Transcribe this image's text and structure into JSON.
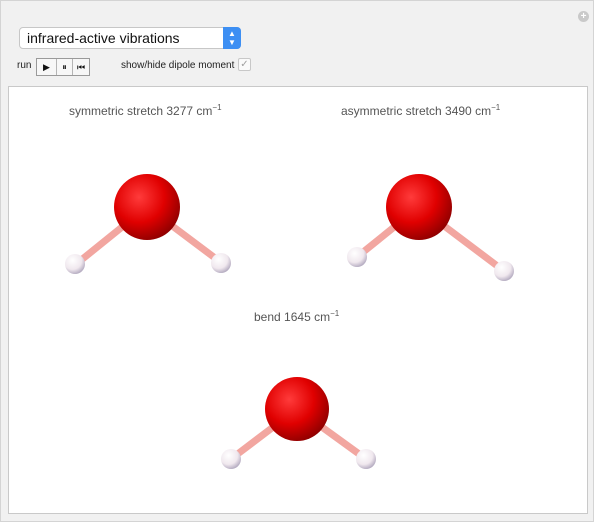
{
  "controls": {
    "dropdown_value": "infrared-active vibrations",
    "run_label": "run",
    "play_symbol": "▶",
    "pause_symbol": "⏸",
    "reset_symbol": "⏮",
    "dipole_label": "show/hide dipole moment",
    "dipole_checked": "✓",
    "corner_button": "+"
  },
  "modes": [
    {
      "name": "symmetric stretch",
      "wavenumber": "3277",
      "unit": "cm",
      "exponent": "−1"
    },
    {
      "name": "asymmetric stretch",
      "wavenumber": "3490",
      "unit": "cm",
      "exponent": "−1"
    },
    {
      "name": "bend",
      "wavenumber": "1645",
      "unit": "cm",
      "exponent": "−1"
    }
  ],
  "colors": {
    "oxygen": "#e00000",
    "hydrogen": "#f4eef2",
    "bond": "#f2a6a0"
  }
}
